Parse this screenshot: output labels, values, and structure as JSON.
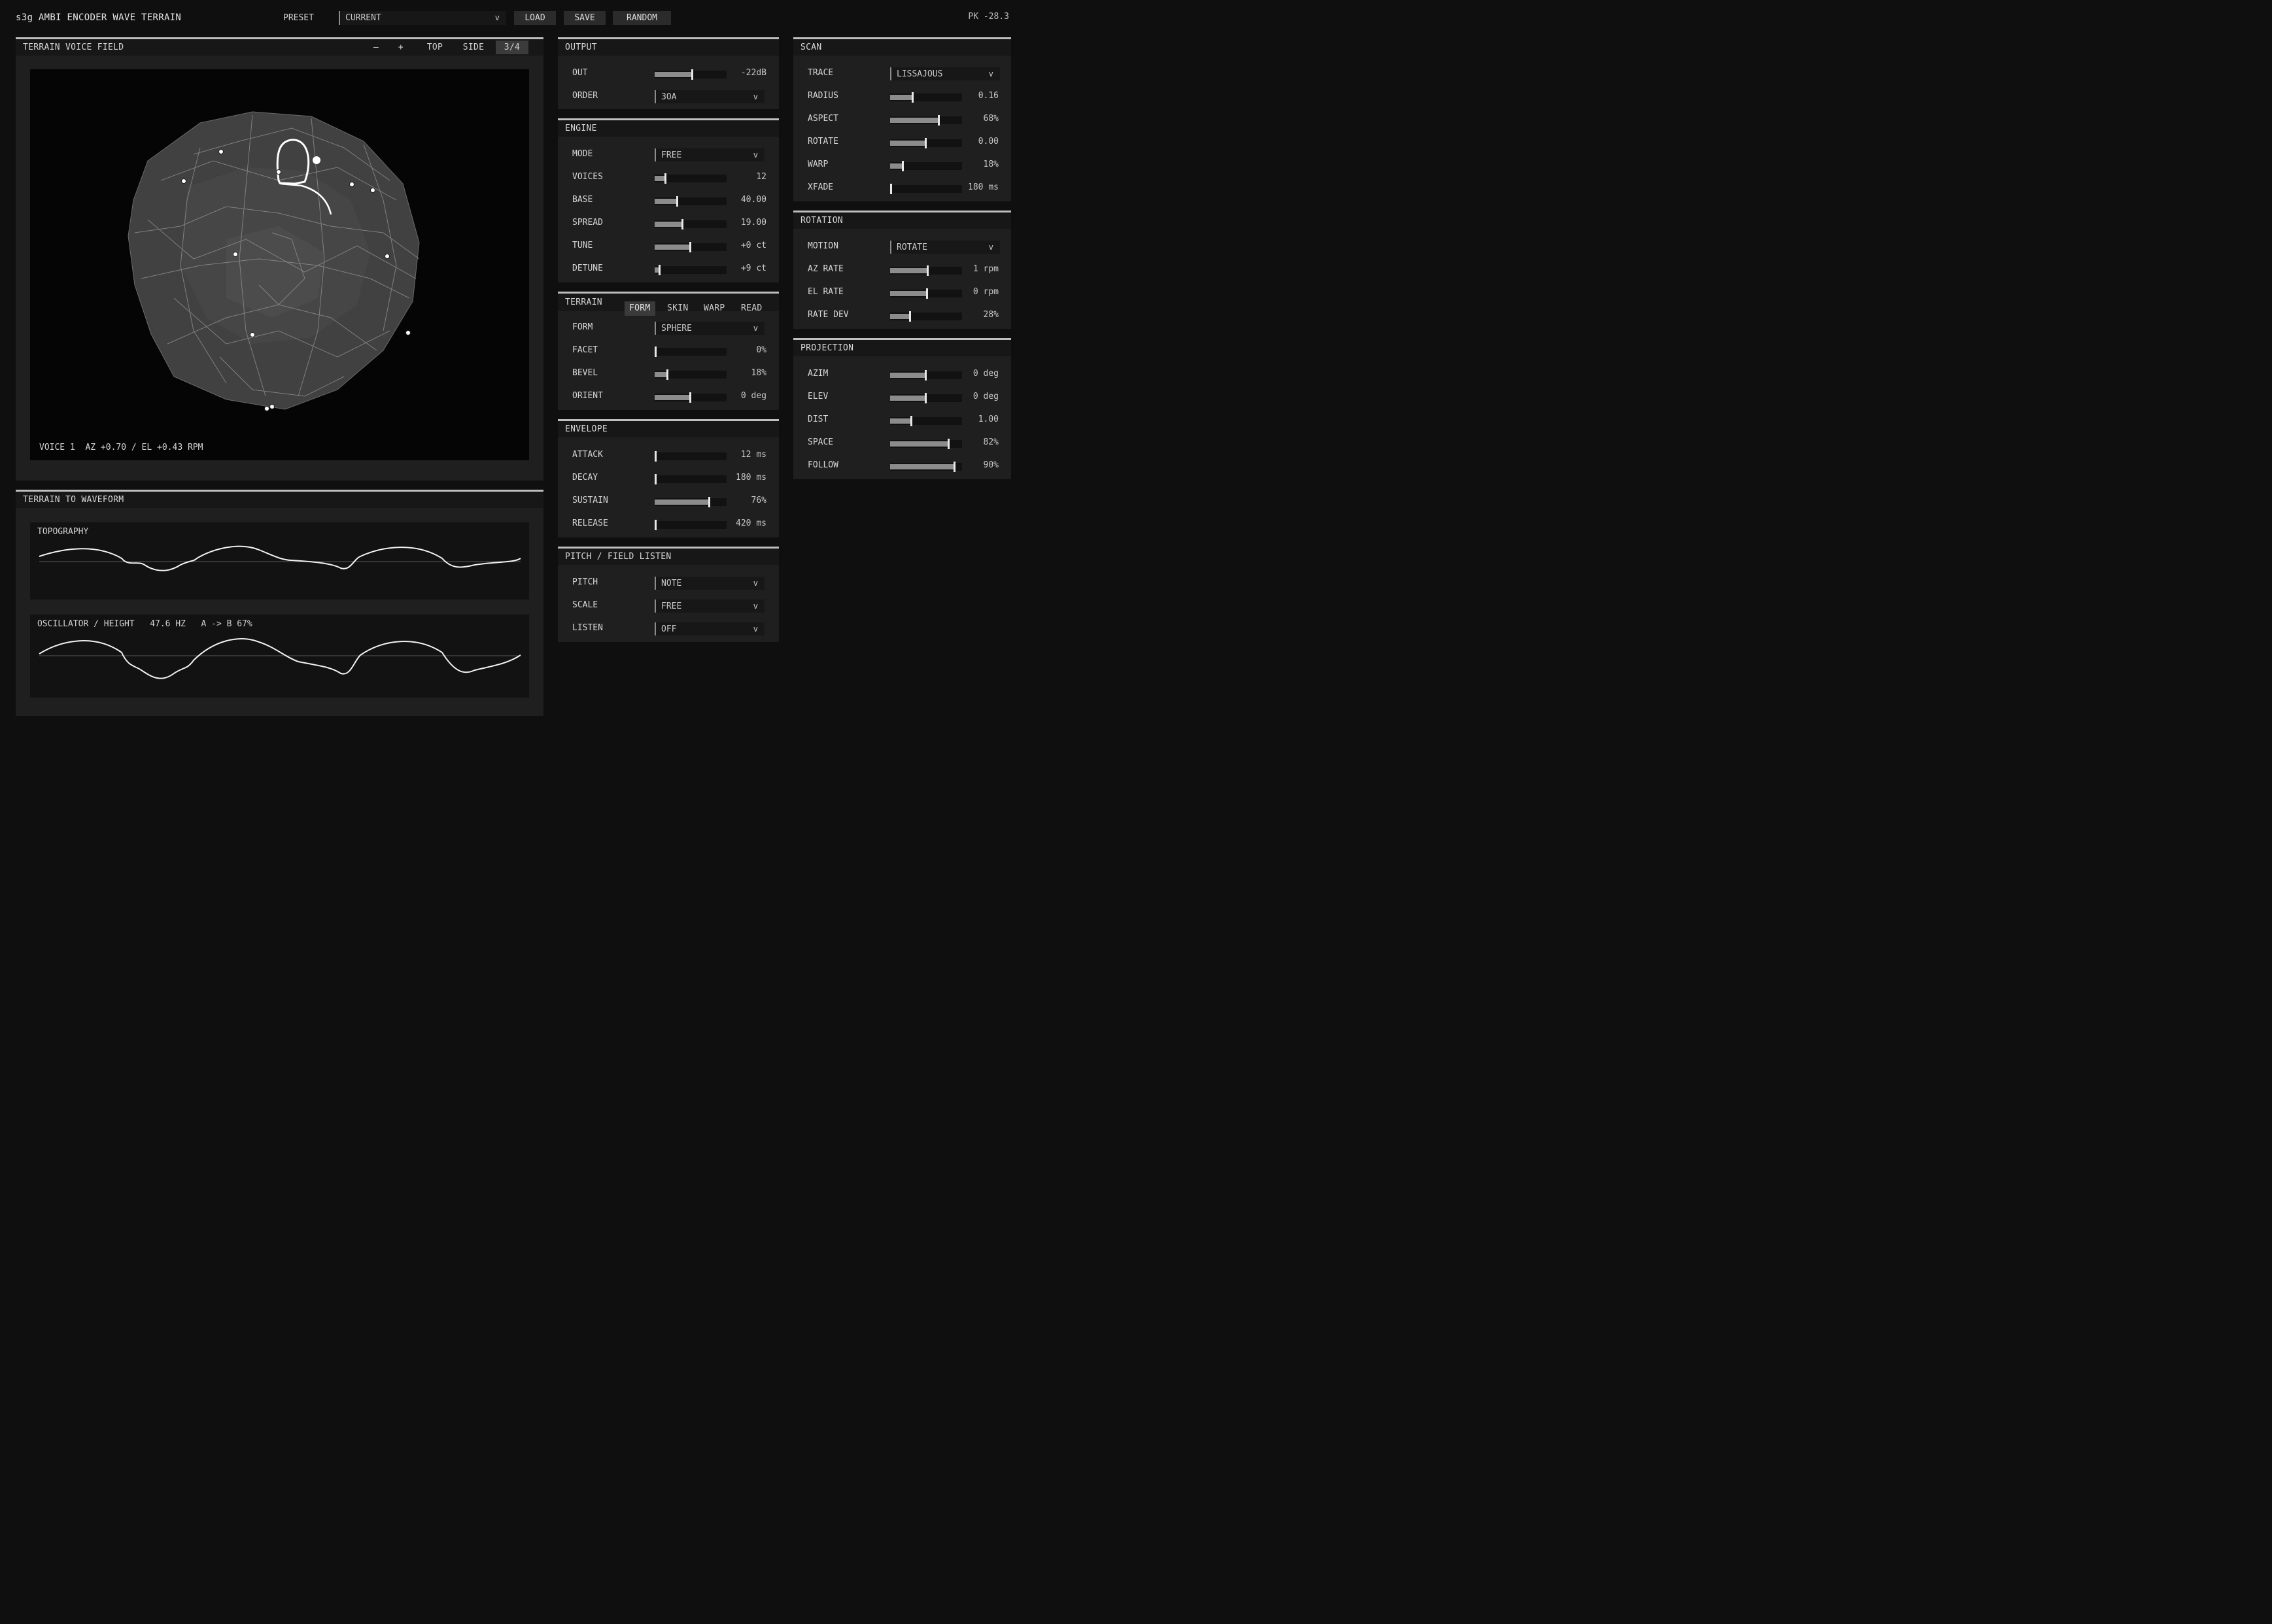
{
  "app": {
    "title": "s3g AMBI ENCODER WAVE TERRAIN",
    "preset_label": "PRESET",
    "preset_value": "CURRENT",
    "load": "LOAD",
    "save": "SAVE",
    "random": "RANDOM",
    "peak": "PK -28.3"
  },
  "terrain_view": {
    "title": "TERRAIN VOICE FIELD",
    "buttons": [
      "–",
      "+",
      "TOP",
      "SIDE",
      "3/4"
    ],
    "active_button": "3/4",
    "readout": "VOICE 1  AZ +0.70 / EL +0.43 RPM"
  },
  "waveform": {
    "title": "TERRAIN TO WAVEFORM",
    "topography_label": "TOPOGRAPHY",
    "osc_label": "OSCILLATOR / HEIGHT",
    "osc_freq": "47.6 HZ",
    "osc_morph": "A -> B 67%"
  },
  "output": {
    "title": "OUTPUT",
    "out_label": "OUT",
    "out_value": "-22dB",
    "out_level": 0.53,
    "order_label": "ORDER",
    "order_value": "3OA"
  },
  "engine": {
    "title": "ENGINE",
    "mode_label": "MODE",
    "mode_value": "FREE",
    "voices_label": "VOICES",
    "voices_value": "12",
    "voices_level": 0.15,
    "base_label": "BASE",
    "base_value": "40.00",
    "base_level": 0.32,
    "spread_label": "SPREAD",
    "spread_value": "19.00",
    "spread_level": 0.39,
    "tune_label": "TUNE",
    "tune_value": "+0 ct",
    "tune_level": 0.5,
    "detune_label": "DETUNE",
    "detune_value": "+9 ct",
    "detune_level": 0.07
  },
  "terrain": {
    "title": "TERRAIN",
    "tabs": [
      "FORM",
      "SKIN",
      "WARP",
      "READ"
    ],
    "active_tab": "FORM",
    "form_label": "FORM",
    "form_value": "SPHERE",
    "facet_label": "FACET",
    "facet_value": "0%",
    "facet_level": 0.0,
    "bevel_label": "BEVEL",
    "bevel_value": "18%",
    "bevel_level": 0.18,
    "orient_label": "ORIENT",
    "orient_value": "0 deg",
    "orient_level": 0.5
  },
  "envelope": {
    "title": "ENVELOPE",
    "attack_label": "ATTACK",
    "attack_value": "12 ms",
    "attack_level": 0.01,
    "decay_label": "DECAY",
    "decay_value": "180 ms",
    "decay_level": 0.02,
    "sustain_label": "SUSTAIN",
    "sustain_value": "76%",
    "sustain_level": 0.76,
    "release_label": "RELEASE",
    "release_value": "420 ms",
    "release_level": 0.02
  },
  "pitch": {
    "title": "PITCH / FIELD LISTEN",
    "pitch_label": "PITCH",
    "pitch_value": "NOTE",
    "scale_label": "SCALE",
    "scale_value": "FREE",
    "listen_label": "LISTEN",
    "listen_value": "OFF"
  },
  "scan": {
    "title": "SCAN",
    "trace_label": "TRACE",
    "trace_value": "LISSAJOUS",
    "radius_label": "RADIUS",
    "radius_value": "0.16",
    "radius_level": 0.32,
    "aspect_label": "ASPECT",
    "aspect_value": "68%",
    "aspect_level": 0.68,
    "rotate_label": "ROTATE",
    "rotate_value": "0.00",
    "rotate_level": 0.5,
    "warp_label": "WARP",
    "warp_value": "18%",
    "warp_level": 0.18,
    "xfade_label": "XFADE",
    "xfade_value": "180 ms",
    "xfade_level": 0.02
  },
  "rotation": {
    "title": "ROTATION",
    "motion_label": "MOTION",
    "motion_value": "ROTATE",
    "az_label": "AZ RATE",
    "az_value": "1 rpm",
    "az_level": 0.53,
    "el_label": "EL RATE",
    "el_value": "0 rpm",
    "el_level": 0.52,
    "dev_label": "RATE DEV",
    "dev_value": "28%",
    "dev_level": 0.28
  },
  "projection": {
    "title": "PROJECTION",
    "azim_label": "AZIM",
    "azim_value": "0 deg",
    "azim_level": 0.5,
    "elev_label": "ELEV",
    "elev_value": "0 deg",
    "elev_level": 0.5,
    "dist_label": "DIST",
    "dist_value": "1.00",
    "dist_level": 0.3,
    "space_label": "SPACE",
    "space_value": "82%",
    "space_level": 0.82,
    "follow_label": "FOLLOW",
    "follow_value": "90%",
    "follow_level": 0.9
  },
  "icons": {
    "dropdown": "chevron-down-icon"
  }
}
